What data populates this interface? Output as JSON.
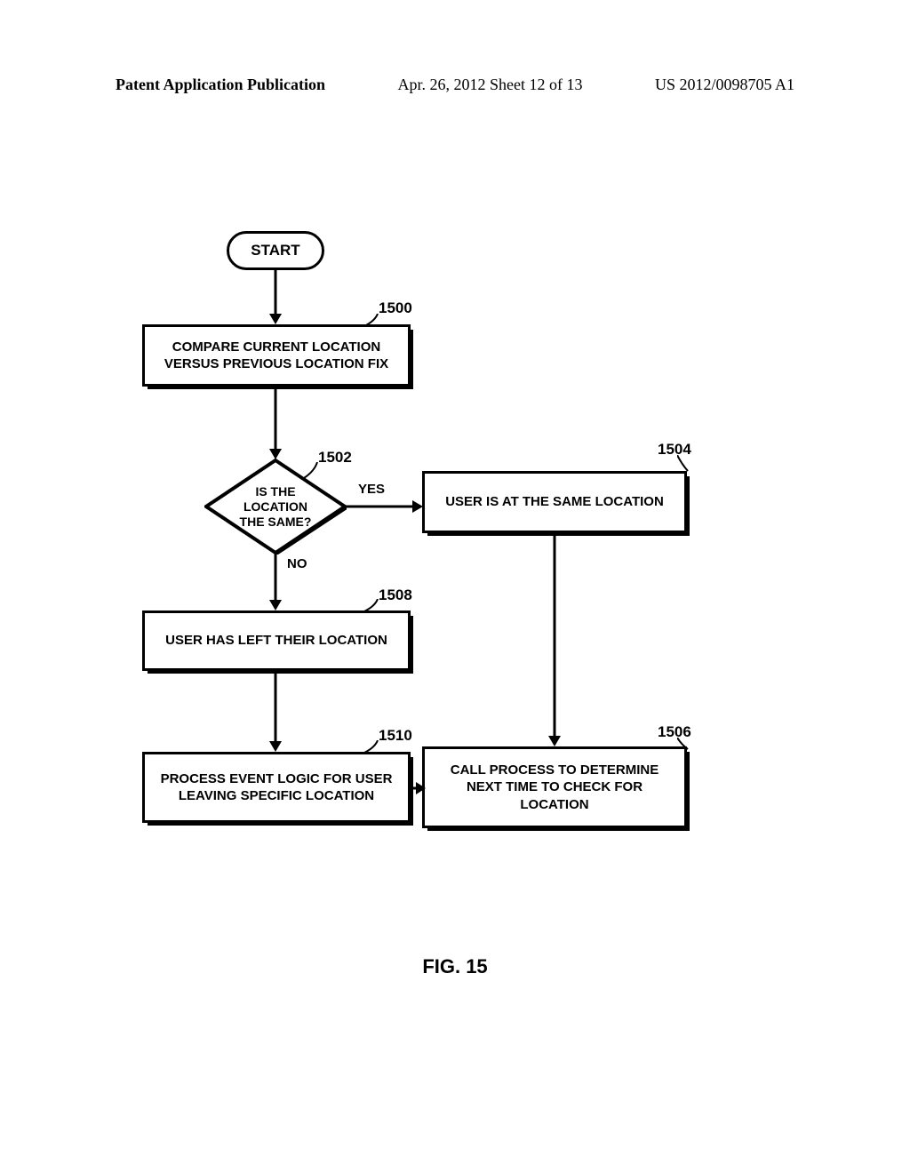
{
  "header": {
    "left": "Patent Application Publication",
    "center": "Apr. 26, 2012  Sheet 12 of 13",
    "right": "US 2012/0098705 A1"
  },
  "flowchart": {
    "start": "START",
    "boxes": {
      "b1500": "COMPARE CURRENT LOCATION VERSUS PREVIOUS LOCATION FIX",
      "b1504": "USER IS AT THE SAME LOCATION",
      "b1508": "USER HAS LEFT THEIR LOCATION",
      "b1510": "PROCESS EVENT LOGIC FOR USER LEAVING SPECIFIC LOCATION",
      "b1506": "CALL PROCESS TO DETERMINE NEXT TIME TO CHECK FOR LOCATION"
    },
    "decision": {
      "d1502": "IS THE LOCATION THE SAME?"
    },
    "edges": {
      "yes": "YES",
      "no": "NO"
    },
    "refs": {
      "r1500": "1500",
      "r1502": "1502",
      "r1504": "1504",
      "r1506": "1506",
      "r1508": "1508",
      "r1510": "1510"
    }
  },
  "caption": "FIG. 15"
}
